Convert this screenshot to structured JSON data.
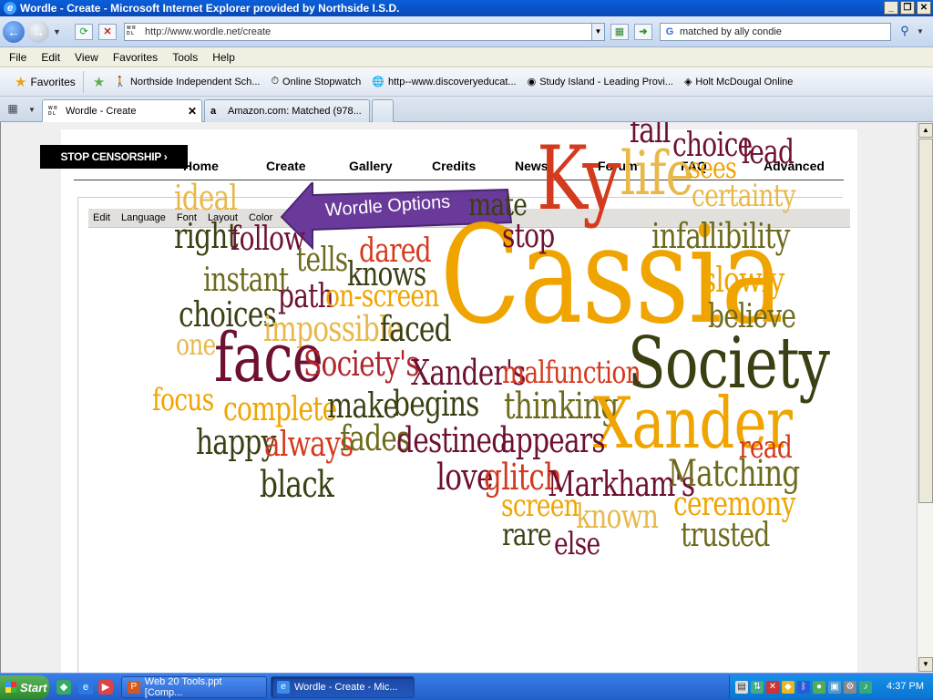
{
  "window": {
    "title": "Wordle - Create - Microsoft Internet Explorer provided by Northside I.S.D.",
    "controls": {
      "minimize": "_",
      "maximize": "❐",
      "close": "✕"
    }
  },
  "address_bar": {
    "url": "http://www.wordle.net/create",
    "search_query": "matched by ally condie"
  },
  "menu": [
    "File",
    "Edit",
    "View",
    "Favorites",
    "Tools",
    "Help"
  ],
  "favorites_bar": {
    "favorites_label": "Favorites",
    "links": [
      "Northside Independent Sch...",
      "Online Stopwatch",
      "http--www.discoveryeducat...",
      "Study Island - Leading Provi...",
      "Holt McDougal Online"
    ]
  },
  "tabs": [
    {
      "label": "Wordle - Create",
      "active": true
    },
    {
      "label": "Amazon.com: Matched (978...",
      "active": false
    }
  ],
  "site": {
    "banner": "STOP CENSORSHIP ›",
    "nav": [
      "Home",
      "Create",
      "Gallery",
      "Credits",
      "News",
      "Forum",
      "FAQ",
      "Advanced"
    ],
    "applet_menu": [
      "Edit",
      "Language",
      "Font",
      "Layout",
      "Color"
    ],
    "callout": "Wordle Options"
  },
  "word_cloud": {
    "colors": {
      "red": "#d43a1e",
      "orange": "#f0a400",
      "yellow": "#e8b84a",
      "dark_olive": "#3b3f12",
      "olive": "#6e6a1c",
      "maroon": "#6e1032",
      "crimson": "#b0242c"
    },
    "words": [
      {
        "text": "Cassia",
        "color": "orange"
      },
      {
        "text": "Ky",
        "color": "red"
      },
      {
        "text": "life",
        "color": "yellow"
      },
      {
        "text": "fall",
        "color": "maroon"
      },
      {
        "text": "choice",
        "color": "maroon"
      },
      {
        "text": "lead",
        "color": "maroon"
      },
      {
        "text": "sees",
        "color": "orange"
      },
      {
        "text": "certainty",
        "color": "yellow"
      },
      {
        "text": "ideal",
        "color": "yellow"
      },
      {
        "text": "mate",
        "color": "dark_olive"
      },
      {
        "text": "right",
        "color": "dark_olive"
      },
      {
        "text": "follow",
        "color": "maroon"
      },
      {
        "text": "stop",
        "color": "maroon"
      },
      {
        "text": "infallibility",
        "color": "olive"
      },
      {
        "text": "tells",
        "color": "olive"
      },
      {
        "text": "dared",
        "color": "red"
      },
      {
        "text": "instant",
        "color": "olive"
      },
      {
        "text": "knows",
        "color": "dark_olive"
      },
      {
        "text": "slowly",
        "color": "orange"
      },
      {
        "text": "path",
        "color": "maroon"
      },
      {
        "text": "on-screen",
        "color": "orange"
      },
      {
        "text": "believe",
        "color": "olive"
      },
      {
        "text": "choices",
        "color": "dark_olive"
      },
      {
        "text": "impossible",
        "color": "yellow"
      },
      {
        "text": "faced",
        "color": "dark_olive"
      },
      {
        "text": "one",
        "color": "yellow"
      },
      {
        "text": "face",
        "color": "maroon"
      },
      {
        "text": "Society's",
        "color": "crimson"
      },
      {
        "text": "Xander's",
        "color": "maroon"
      },
      {
        "text": "malfunction",
        "color": "red"
      },
      {
        "text": "Society",
        "color": "dark_olive"
      },
      {
        "text": "focus",
        "color": "orange"
      },
      {
        "text": "complete",
        "color": "orange"
      },
      {
        "text": "make",
        "color": "dark_olive"
      },
      {
        "text": "begins",
        "color": "dark_olive"
      },
      {
        "text": "thinking",
        "color": "olive"
      },
      {
        "text": "Xander",
        "color": "orange"
      },
      {
        "text": "happy",
        "color": "dark_olive"
      },
      {
        "text": "always",
        "color": "red"
      },
      {
        "text": "fades",
        "color": "olive"
      },
      {
        "text": "destined",
        "color": "maroon"
      },
      {
        "text": "appears",
        "color": "maroon"
      },
      {
        "text": "read",
        "color": "red"
      },
      {
        "text": "black",
        "color": "dark_olive"
      },
      {
        "text": "love",
        "color": "maroon"
      },
      {
        "text": "glitch",
        "color": "red"
      },
      {
        "text": "Markham's",
        "color": "maroon"
      },
      {
        "text": "Matching",
        "color": "olive"
      },
      {
        "text": "screen",
        "color": "orange"
      },
      {
        "text": "known",
        "color": "yellow"
      },
      {
        "text": "ceremony",
        "color": "orange"
      },
      {
        "text": "rare",
        "color": "dark_olive"
      },
      {
        "text": "else",
        "color": "maroon"
      },
      {
        "text": "trusted",
        "color": "olive"
      }
    ]
  },
  "taskbar": {
    "start": "Start",
    "tasks": [
      "Web 20 Tools.ppt [Comp...",
      "Wordle - Create - Mic..."
    ],
    "clock": "4:37 PM"
  }
}
